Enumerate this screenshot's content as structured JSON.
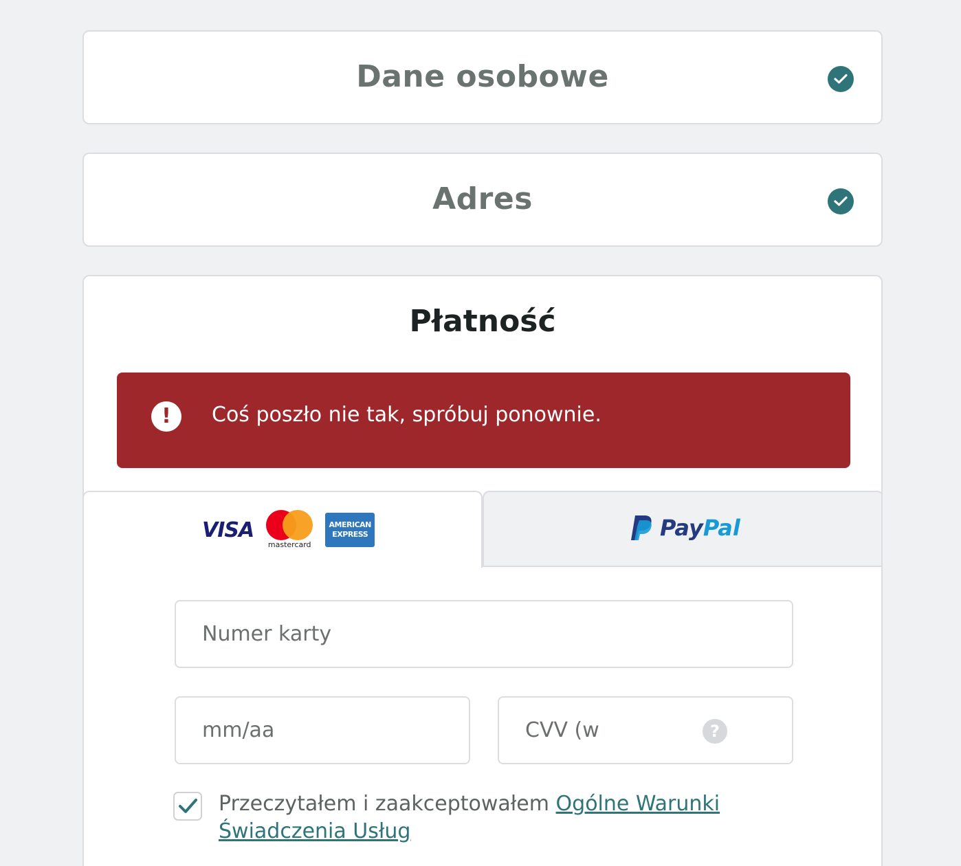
{
  "steps": {
    "personal": {
      "title": "Dane osobowe",
      "status_icon": "check-circle-icon"
    },
    "address": {
      "title": "Adres",
      "status_icon": "check-circle-icon"
    },
    "payment": {
      "title": "Płatność"
    }
  },
  "error": {
    "icon": "!",
    "message": "Coś poszło nie tak, spróbuj ponownie."
  },
  "payment_tabs": {
    "cards": {
      "visa": "VISA",
      "mastercard": "mastercard",
      "amex_line1": "AMERICAN",
      "amex_line2": "EXPRESS"
    },
    "paypal": {
      "pay": "Pay",
      "pal": "Pal"
    }
  },
  "form": {
    "card_number_placeholder": "Numer karty",
    "expiry_placeholder": "mm/aa",
    "cvv_placeholder": "CVV (w",
    "cvv_help": "?"
  },
  "terms": {
    "checked": true,
    "text": "Przeczytałem i zaakceptowałem ",
    "link": "Ogólne Warunki Świadczenia Usług"
  },
  "colors": {
    "accent": "#2e7478",
    "error": "#9e272b",
    "background": "#f0f1f3"
  }
}
